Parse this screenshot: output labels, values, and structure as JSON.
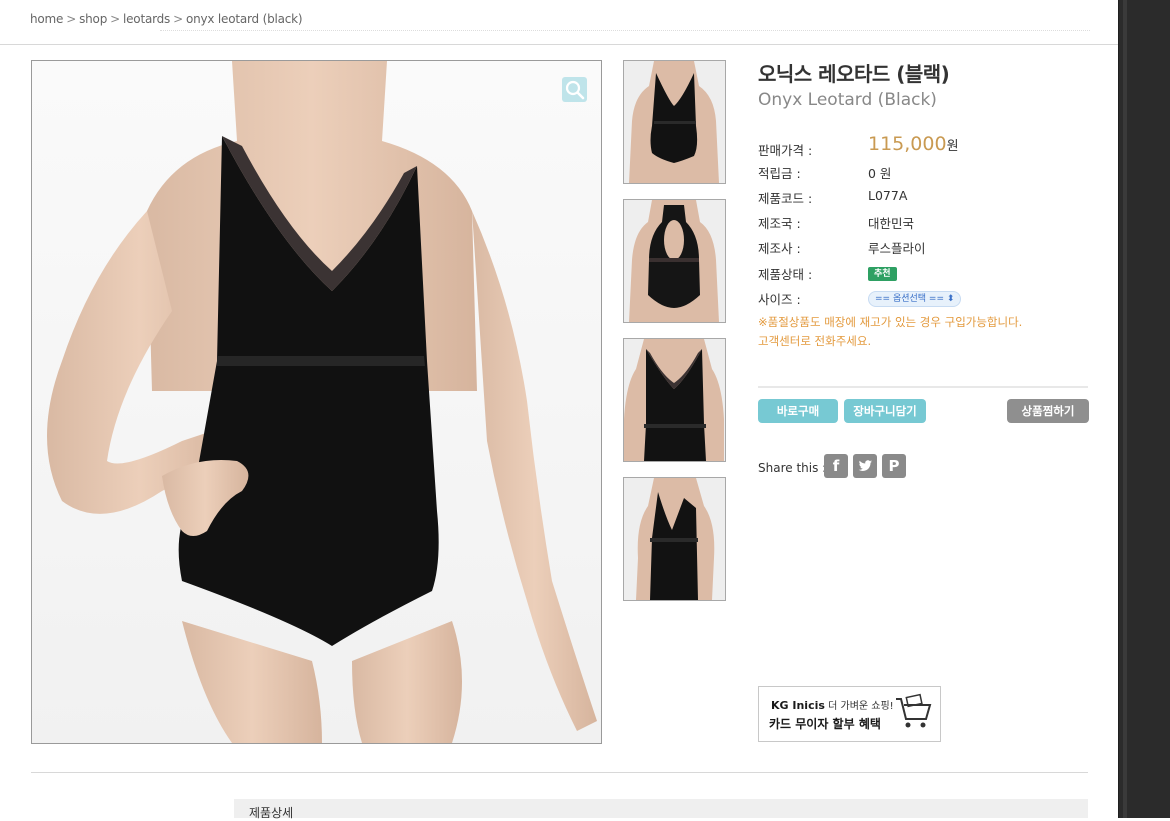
{
  "breadcrumb": {
    "items": [
      "home",
      "shop",
      "leotards",
      "onyx leotard (black)"
    ],
    "separator": ">"
  },
  "product": {
    "title_ko": "오닉스 레오타드 (블랙)",
    "title_en": "Onyx Leotard (Black)",
    "price_label": "판매가격 :",
    "price_value": "115,000",
    "price_unit": "원",
    "points_label": "적립금 :",
    "points_value": "0 원",
    "code_label": "제품코드 :",
    "code_value": "L077A",
    "country_label": "제조국 :",
    "country_value": "대한민국",
    "maker_label": "제조사 :",
    "maker_value": "루스플라이",
    "status_label": "제품상태 :",
    "status_badge": "추천",
    "size_label": "사이즈 :",
    "size_select": "== 옵션선택 ==",
    "notice_line1": "※품절상품도 매장에 재고가 있는 경우 구입가능합니다.",
    "notice_line2": "고객센터로 전화주세요."
  },
  "actions": {
    "buy": "바로구매",
    "cart": "장바구니담기",
    "wishlist": "상품찜하기"
  },
  "share": {
    "label": "Share this :",
    "icons": [
      "facebook-icon",
      "twitter-icon",
      "pinterest-icon"
    ]
  },
  "banner": {
    "brand": "KG Inicis",
    "tagline": "더 가벼운 쇼핑!",
    "main": "카드 무이자 할부 혜택"
  },
  "detail": {
    "tab_label": "제품상세"
  },
  "colors": {
    "accent_button": "#77c9d3",
    "wish_button": "#8f8f8f",
    "price": "#c99a52",
    "notice": "#e39a3e",
    "badge": "#2ea063"
  }
}
